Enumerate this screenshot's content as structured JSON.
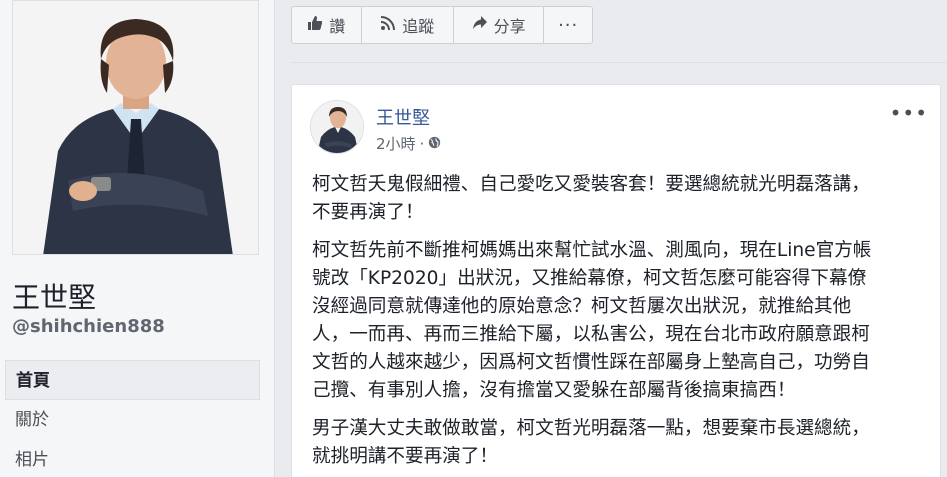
{
  "page": {
    "name": "王世堅",
    "handle": "@shihchien888"
  },
  "nav": {
    "items": [
      {
        "label": "首頁",
        "active": true
      },
      {
        "label": "關於",
        "active": false
      },
      {
        "label": "相片",
        "active": false
      }
    ]
  },
  "actions": {
    "like_label": "讚",
    "follow_label": "追蹤",
    "share_label": "分享",
    "more_label": "···"
  },
  "post": {
    "author": "王世堅",
    "time": "2小時",
    "separator": "·",
    "more_label": "•••",
    "paragraphs": [
      "柯文哲夭鬼假細禮、自己愛吃又愛裝客套！要選總統就光明磊落講，\n不要再演了！",
      "柯文哲先前不斷推柯媽媽出來幫忙試水溫、測風向，現在Line官方帳\n號改「KP2020」出狀況，又推給幕僚，柯文哲怎麼可能容得下幕僚\n沒經過同意就傳達他的原始意念？柯文哲屢次出狀況，就推給其他\n人，一而再、再而三推給下屬，以私害公，現在台北市政府願意跟柯\n文哲的人越來越少，因爲柯文哲慣性踩在部屬身上墊高自己，功勞自\n己攬、有事別人擔，沒有擔當又愛躲在部屬背後搞東搞西！",
      "男子漢大丈夫敢做敢當，柯文哲光明磊落一點，想要棄市長選總統，\n就挑明講不要再演了！"
    ]
  },
  "icons": {
    "like": "thumbs-up-icon",
    "follow": "rss-icon",
    "share": "share-arrow-icon",
    "privacy": "globe-icon"
  },
  "colors": {
    "link": "#385898",
    "background": "#e9ebee",
    "text": "#1d2129",
    "secondary_text": "#606770"
  }
}
